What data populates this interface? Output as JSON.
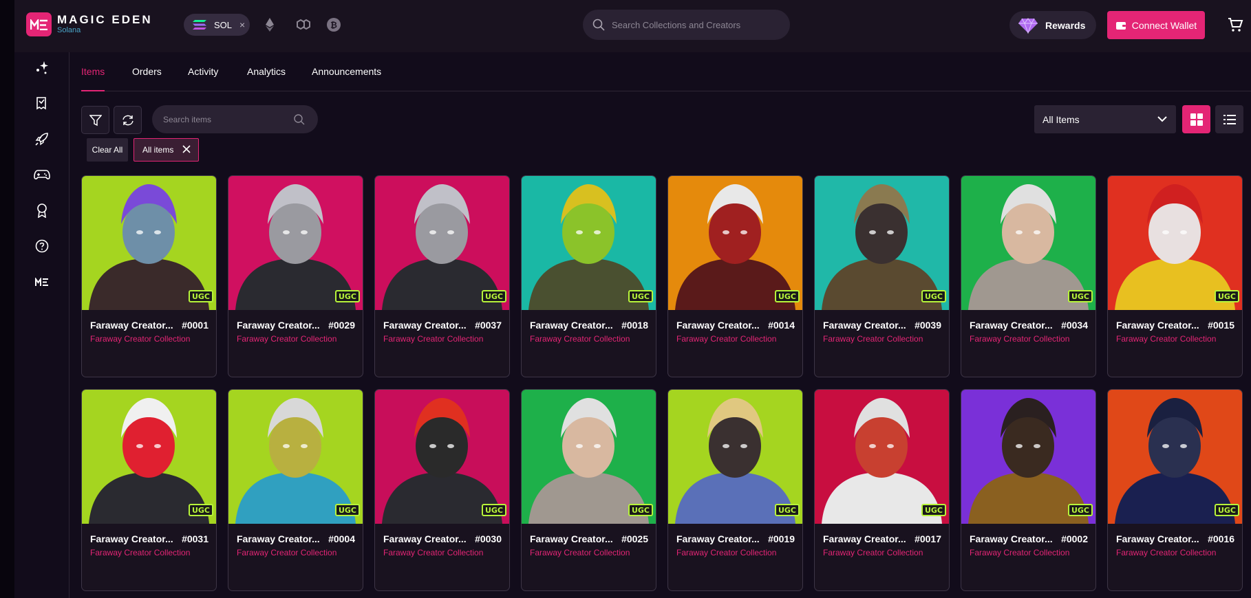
{
  "brand": {
    "name": "MAGIC EDEN",
    "sub": "Solana",
    "mark": "ME",
    "accent": "#e42575"
  },
  "chain_filter": {
    "label": "SOL",
    "close": "×",
    "icons": [
      "ethereum-icon",
      "polygon-icon",
      "bitcoin-icon"
    ]
  },
  "search": {
    "placeholder": "Search Collections and Creators"
  },
  "header": {
    "rewards_label": "Rewards",
    "connect_label": "Connect Wallet"
  },
  "sidebar": {
    "items": [
      "sparkle-icon",
      "receipt-icon",
      "rocket-icon",
      "gamepad-icon",
      "award-icon",
      "help-icon",
      "magic-eden-logo-icon"
    ]
  },
  "tabs": [
    {
      "label": "Items",
      "active": true
    },
    {
      "label": "Orders"
    },
    {
      "label": "Activity"
    },
    {
      "label": "Analytics"
    },
    {
      "label": "Announcements"
    }
  ],
  "filters": {
    "search_placeholder": "Search items",
    "sort_label": "All Items",
    "clear_all": "Clear All",
    "chip_label": "All items"
  },
  "badge": "UGC",
  "cards": [
    {
      "name": "Faraway Creator...",
      "num": "#0001",
      "collection": "Faraway Creator Collection",
      "bg": "#a5d520",
      "body": "#3a2a2a",
      "head": "#6e8fa8",
      "hair": "#7a4ad8"
    },
    {
      "name": "Faraway Creator...",
      "num": "#0029",
      "collection": "Faraway Creator Collection",
      "bg": "#d01060",
      "body": "#2a2a30",
      "head": "#9a9aa0",
      "hair": "#c0c0c8"
    },
    {
      "name": "Faraway Creator...",
      "num": "#0037",
      "collection": "Faraway Creator Collection",
      "bg": "#cc0e5c",
      "body": "#2a2a30",
      "head": "#9a9aa0",
      "hair": "#c0c0c8"
    },
    {
      "name": "Faraway Creator...",
      "num": "#0018",
      "collection": "Faraway Creator Collection",
      "bg": "#1ab8a5",
      "body": "#4a5030",
      "head": "#8bc32a",
      "hair": "#d8c020"
    },
    {
      "name": "Faraway Creator...",
      "num": "#0014",
      "collection": "Faraway Creator Collection",
      "bg": "#e58a0c",
      "body": "#5a1a1a",
      "head": "#a02020",
      "hair": "#e8e8e8"
    },
    {
      "name": "Faraway Creator...",
      "num": "#0039",
      "collection": "Faraway Creator Collection",
      "bg": "#20b8a8",
      "body": "#5a4a30",
      "head": "#3a3030",
      "hair": "#8a7a50"
    },
    {
      "name": "Faraway Creator...",
      "num": "#0034",
      "collection": "Faraway Creator Collection",
      "bg": "#1eb04a",
      "body": "#a09890",
      "head": "#d8b8a0",
      "hair": "#e0e0e0"
    },
    {
      "name": "Faraway Creator...",
      "num": "#0015",
      "collection": "Faraway Creator Collection",
      "bg": "#e03020",
      "body": "#e8c020",
      "head": "#e8e0e0",
      "hair": "#d02020"
    },
    {
      "name": "Faraway Creator...",
      "num": "#0031",
      "collection": "Faraway Creator Collection",
      "bg": "#a5d520",
      "body": "#2a2a30",
      "head": "#e02030",
      "hair": "#f0f0f0"
    },
    {
      "name": "Faraway Creator...",
      "num": "#0004",
      "collection": "Faraway Creator Collection",
      "bg": "#a5d520",
      "body": "#30a0c0",
      "head": "#b8b040",
      "hair": "#d8d8d8"
    },
    {
      "name": "Faraway Creator...",
      "num": "#0030",
      "collection": "Faraway Creator Collection",
      "bg": "#c80e5a",
      "body": "#2a2a30",
      "head": "#2a2a2a",
      "hair": "#e03020"
    },
    {
      "name": "Faraway Creator...",
      "num": "#0025",
      "collection": "Faraway Creator Collection",
      "bg": "#1eb04a",
      "body": "#a09890",
      "head": "#d8b8a0",
      "hair": "#e0e0e0"
    },
    {
      "name": "Faraway Creator...",
      "num": "#0019",
      "collection": "Faraway Creator Collection",
      "bg": "#a5d520",
      "body": "#5a70b8",
      "head": "#3a3030",
      "hair": "#e0c880"
    },
    {
      "name": "Faraway Creator...",
      "num": "#0017",
      "collection": "Faraway Creator Collection",
      "bg": "#c80e40",
      "body": "#e8e8e8",
      "head": "#c84030",
      "hair": "#e0e0e0"
    },
    {
      "name": "Faraway Creator...",
      "num": "#0002",
      "collection": "Faraway Creator Collection",
      "bg": "#7a30d8",
      "body": "#8a6020",
      "head": "#3a2a20",
      "hair": "#2a2020"
    },
    {
      "name": "Faraway Creator...",
      "num": "#0016",
      "collection": "Faraway Creator Collection",
      "bg": "#e04818",
      "body": "#1a2050",
      "head": "#2a3050",
      "hair": "#1a2040"
    }
  ]
}
